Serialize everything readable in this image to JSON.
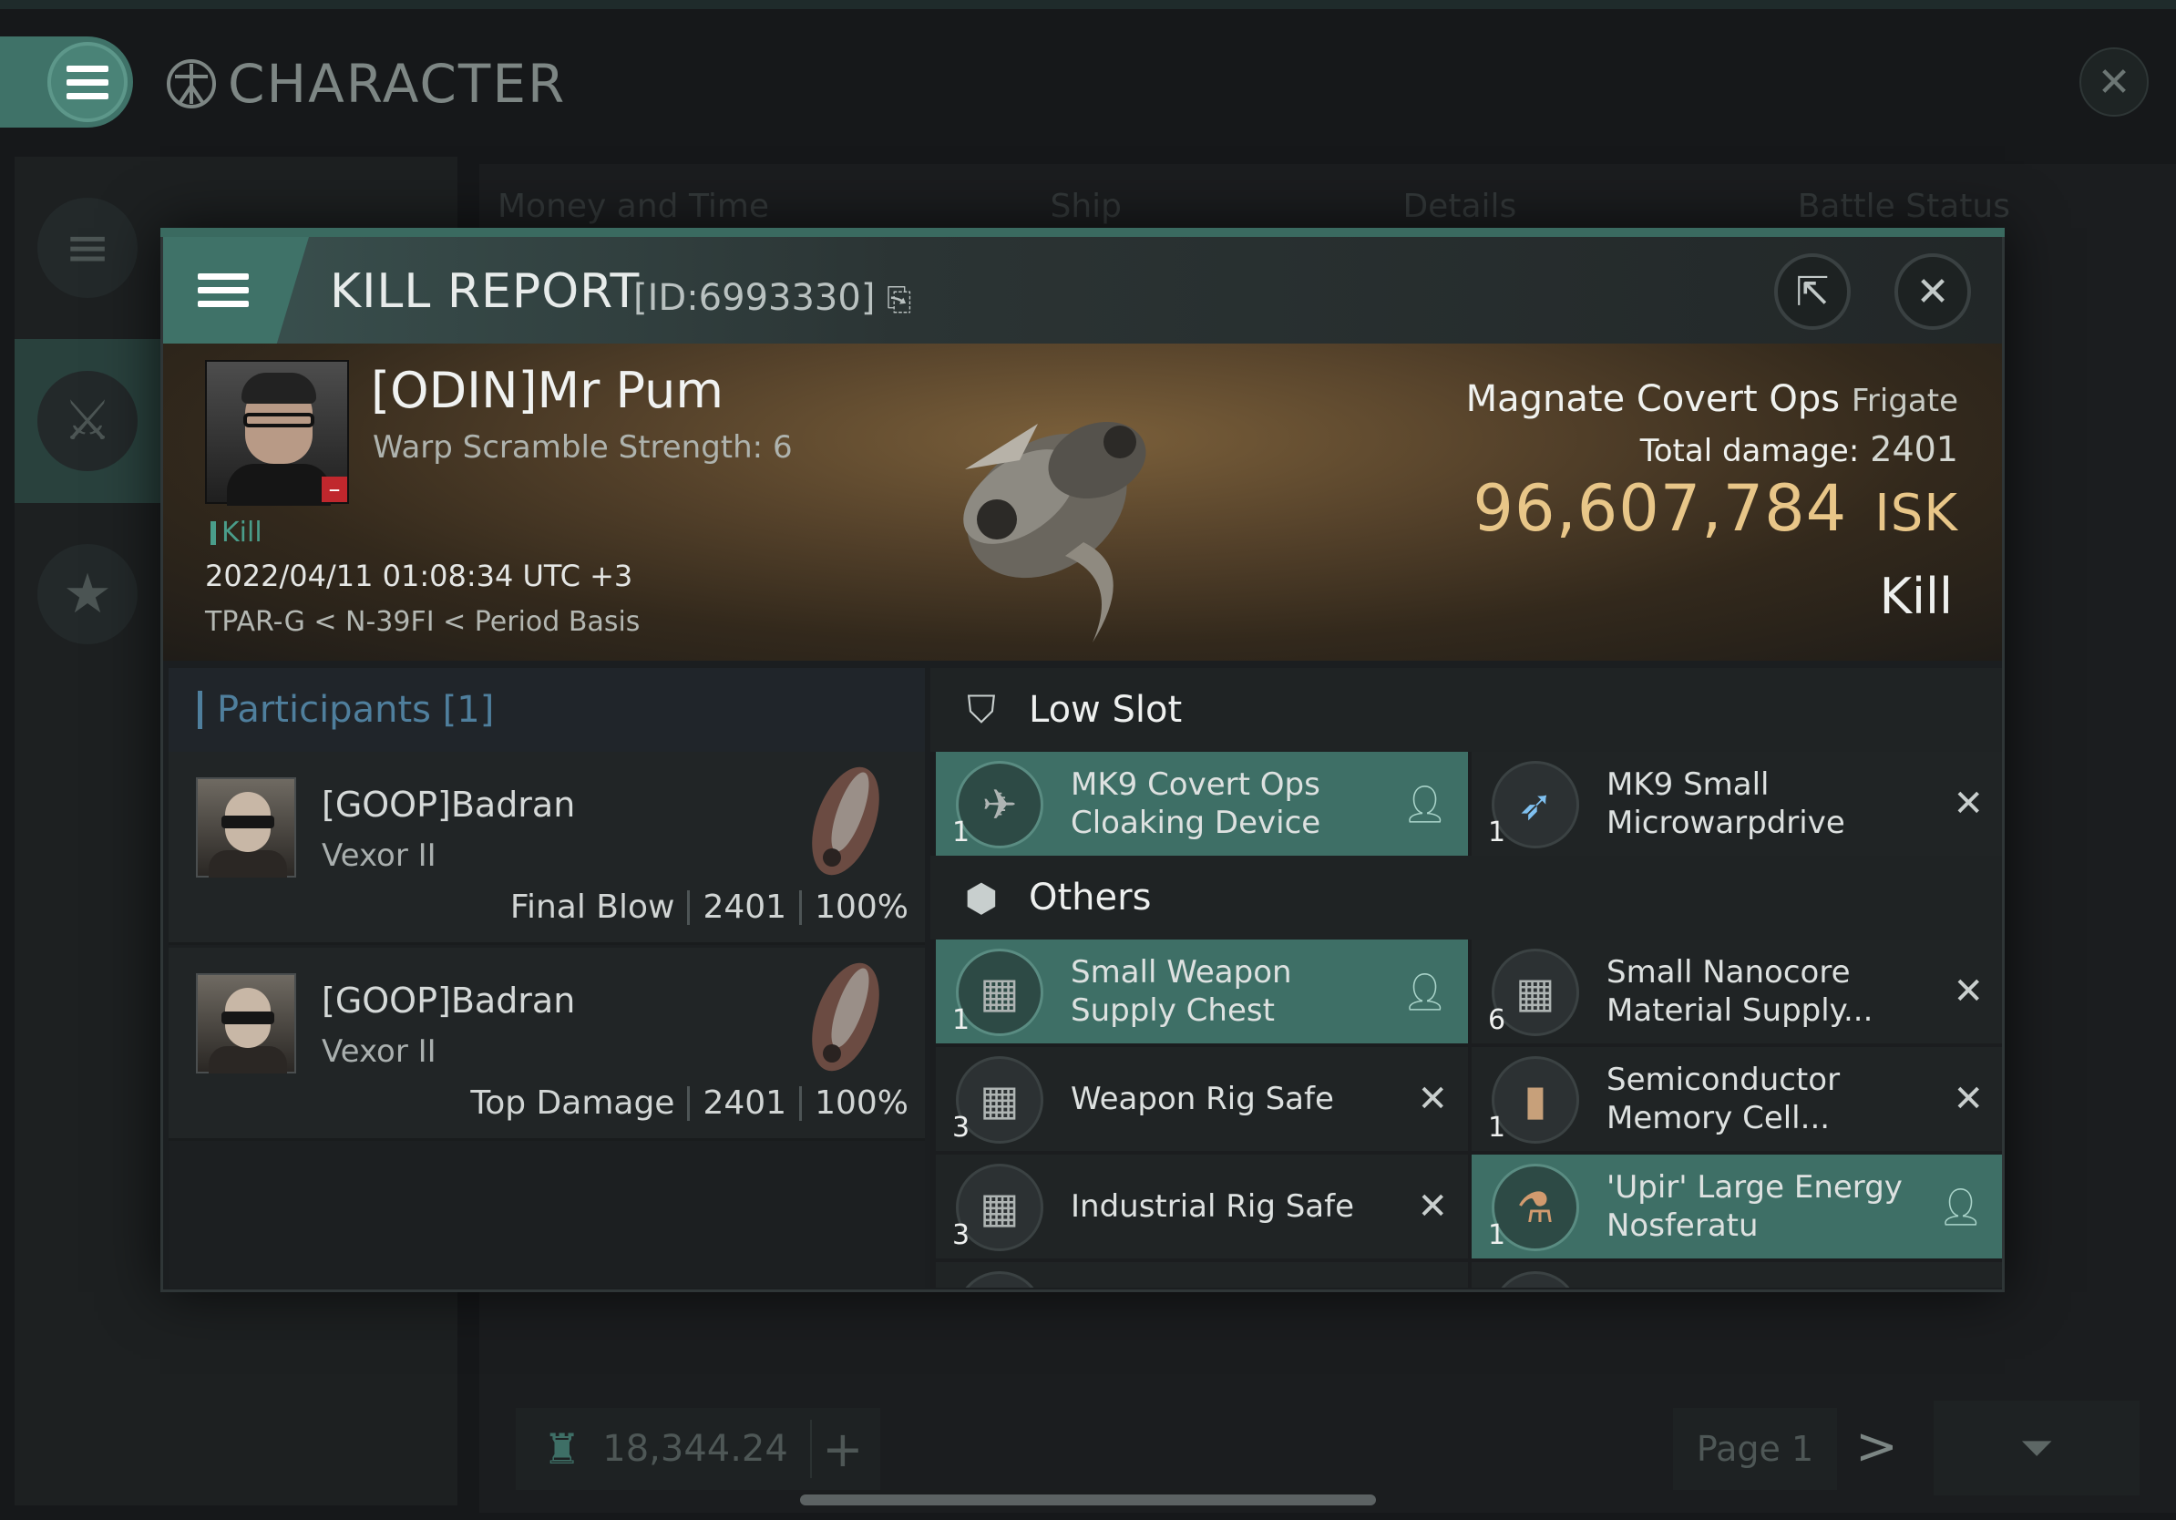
{
  "app": {
    "title": "CHARACTER",
    "tabs": [
      "Money and Time",
      "Ship",
      "Details",
      "Battle Status"
    ],
    "footer": {
      "isk": "18,344.24",
      "plus": "+",
      "page": "Page 1",
      "next": ">"
    }
  },
  "report": {
    "title": "KILL REPORT",
    "id": "[ID:6993330]",
    "victim": {
      "name": "[ODIN]Mr Pum",
      "scram": "Warp Scramble Strength: 6",
      "tag": "Kill",
      "time": "2022/04/11 01:08:34 UTC +3",
      "location": "TPAR-G < N-39FI < Period Basis"
    },
    "ship": {
      "name": "Magnate Covert Ops",
      "class": "Frigate",
      "total_damage_label": "Total damage:",
      "total_damage": "2401",
      "isk": "96,607,784",
      "isk_unit": "ISK",
      "result": "Kill"
    },
    "participants": {
      "title": "Participants [1]",
      "rows": [
        {
          "name": "[GOOP]Badran",
          "ship": "Vexor II",
          "role": "Final Blow",
          "damage": "2401",
          "percent": "100%"
        },
        {
          "name": "[GOOP]Badran",
          "ship": "Vexor II",
          "role": "Top Damage",
          "damage": "2401",
          "percent": "100%"
        }
      ]
    },
    "fitting": {
      "low_slot": "Low Slot",
      "others": "Others",
      "low_items": [
        {
          "name": "MK9 Covert Ops Cloaking Device",
          "qty": "1",
          "status": "dropped"
        },
        {
          "name": "MK9 Small Microwarpdrive",
          "qty": "1",
          "status": "destroyed"
        }
      ],
      "other_items": [
        {
          "name": "Small Weapon Supply Chest",
          "qty": "1",
          "status": "dropped"
        },
        {
          "name": "Small Nanocore Material Supply...",
          "qty": "6",
          "status": "destroyed"
        },
        {
          "name": "Weapon Rig Safe",
          "qty": "3",
          "status": "destroyed"
        },
        {
          "name": "Semiconductor Memory Cell...",
          "qty": "1",
          "status": "destroyed"
        },
        {
          "name": "Industrial Rig Safe",
          "qty": "3",
          "status": "destroyed"
        },
        {
          "name": "'Upir' Large Energy Nosferatu",
          "qty": "1",
          "status": "dropped"
        }
      ]
    }
  },
  "colors": {
    "accent": "#3e6f66",
    "isk": "#e8c688",
    "participants": "#4f7f9d",
    "loss": "#c0272d"
  }
}
